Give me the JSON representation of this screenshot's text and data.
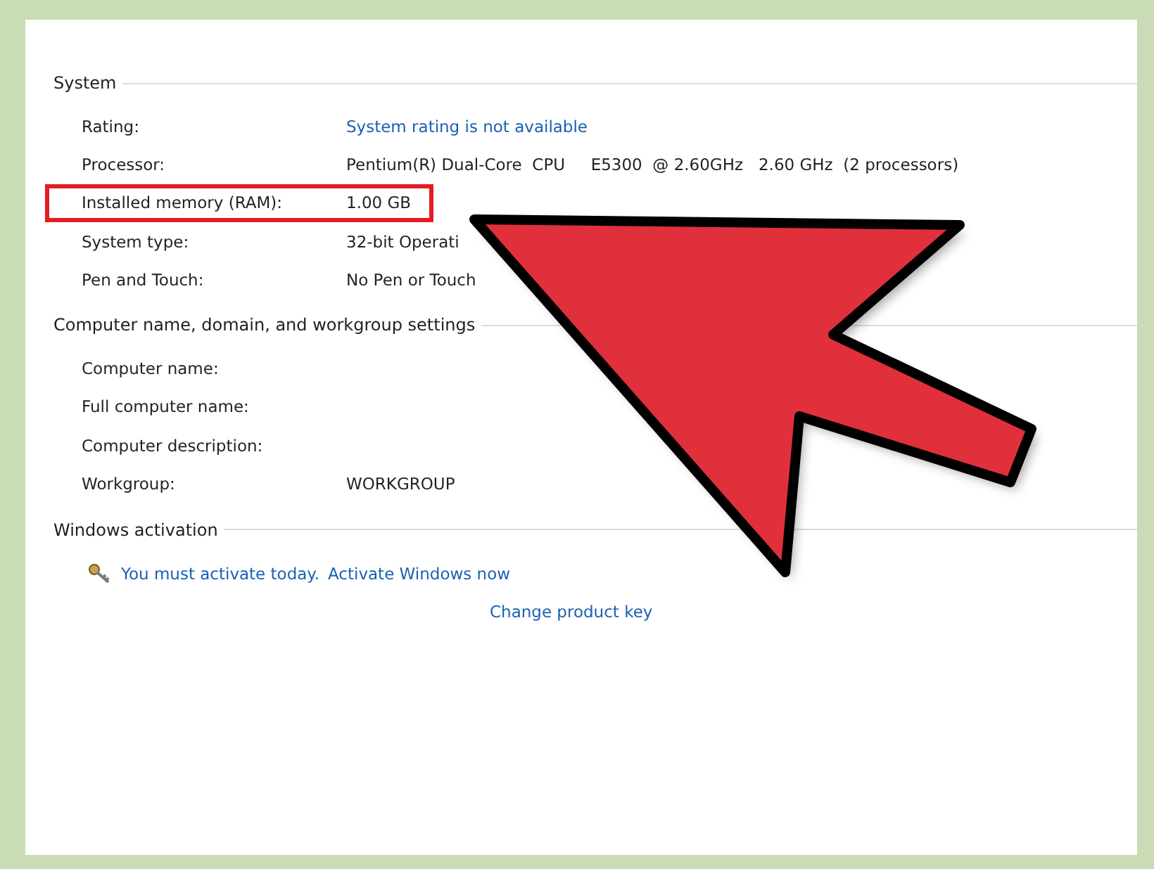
{
  "sections": [
    {
      "heading": "System",
      "rows": [
        {
          "label": "Rating:",
          "value": "System rating is not available",
          "kind": "link",
          "highlighted": false
        },
        {
          "label": "Processor:",
          "value": "Pentium(R) Dual-Core  CPU     E5300  @ 2.60GHz   2.60 GHz  (2 processors)",
          "kind": "text",
          "highlighted": false
        },
        {
          "label": "Installed memory (RAM):",
          "value": "1.00 GB",
          "kind": "text",
          "highlighted": true
        },
        {
          "label": "System type:",
          "value": "32-bit Operati",
          "kind": "text",
          "highlighted": false
        },
        {
          "label": "Pen and Touch:",
          "value": "No Pen or Touch",
          "kind": "text",
          "highlighted": false
        }
      ]
    },
    {
      "heading": "Computer name, domain, and workgroup settings",
      "rows": [
        {
          "label": "Computer name:",
          "highlighted": false
        },
        {
          "label": "Full computer name:",
          "highlighted": false
        },
        {
          "label": "Computer description:",
          "highlighted": false
        },
        {
          "label": "Workgroup:",
          "value": "WORKGROUP",
          "kind": "text",
          "highlighted": false
        }
      ]
    }
  ],
  "activation": {
    "heading": "Windows activation",
    "status": "You must activate today.",
    "activate_link": "Activate Windows now",
    "change_key_link": "Change product key"
  },
  "overlay": {
    "kind": "arrow"
  }
}
